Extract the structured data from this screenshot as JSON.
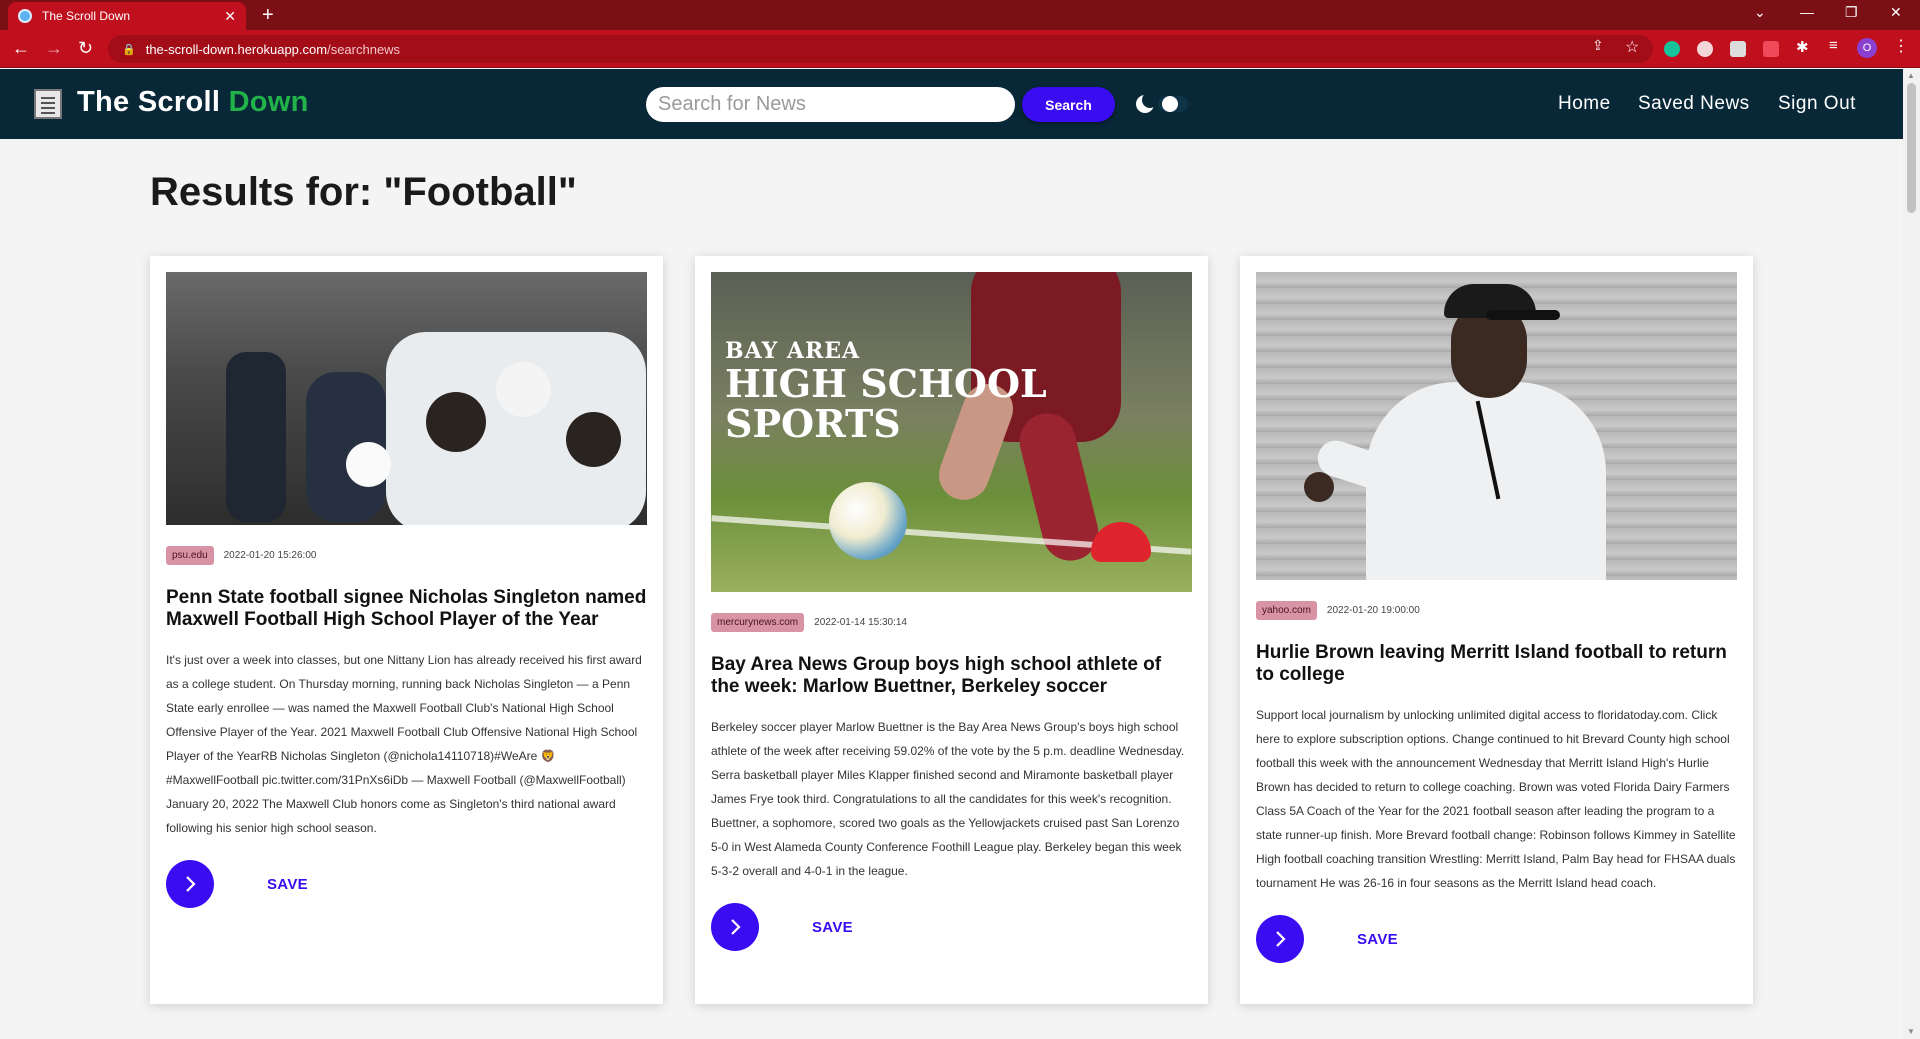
{
  "browser": {
    "tab_title": "The Scroll Down",
    "url_host": "the-scroll-down.herokuapp.com",
    "url_path": "/searchnews",
    "accent": "#c0101e"
  },
  "header": {
    "brand_main": "The Scroll ",
    "brand_accent": "Down",
    "search_placeholder": "Search for News",
    "search_button": "Search",
    "nav": [
      "Home",
      "Saved News",
      "Sign Out"
    ],
    "background": "#082838",
    "brand_accent_color": "#21b34a",
    "button_color": "#3a0cf2"
  },
  "results": {
    "title": "Results for: \"Football\""
  },
  "cards": [
    {
      "source": "psu.edu",
      "date": "2022-01-20 15:26:00",
      "title": "Penn State football signee Nicholas Singleton named Maxwell Football High School Player of the Year",
      "description": "It's just over a week into classes, but one Nittany Lion has already received his first award as a college student. On Thursday morning, running back Nicholas Singleton — a Penn State early enrollee — was named the Maxwell Football Club's National High School Offensive Player of the Year. 2021 Maxwell Football Club Offensive National High School Player of the YearRB Nicholas Singleton (@nichola14110718)#WeAre 🦁 #MaxwellFootball pic.twitter.com/31PnXs6iDb — Maxwell Football (@MaxwellFootball) January 20, 2022 The Maxwell Club honors come as Singleton's third national award following his senior high school season.",
      "save_label": "SAVE"
    },
    {
      "source": "mercurynews.com",
      "date": "2022-01-14 15:30:14",
      "title": "Bay Area News Group boys high school athlete of the week: Marlow Buettner, Berkeley soccer",
      "description": "Berkeley soccer player Marlow Buettner is the Bay Area News Group's boys high school athlete of the week after receiving 59.02% of the vote by the 5 p.m. deadline Wednesday. Serra basketball player Miles Klapper finished second and Miramonte basketball player James Frye took third. Congratulations to all the candidates for this week's recognition. Buettner, a sophomore, scored two goals as the Yellowjackets cruised past San Lorenzo 5-0 in West Alameda County Conference Foothill League play. Berkeley began this week 5-3-2 overall and 4-0-1 in the league.",
      "image_text_1": "BAY AREA",
      "image_text_2": "HIGH SCHOOL SPORTS",
      "save_label": "SAVE"
    },
    {
      "source": "yahoo.com",
      "date": "2022-01-20 19:00:00",
      "title": "Hurlie Brown leaving Merritt Island football to return to college",
      "description": "Support local journalism by unlocking unlimited digital access to floridatoday.com. Click here to explore subscription options. Change continued to hit Brevard County high school football this week with the announcement Wednesday that Merritt Island High's Hurlie Brown has decided to return to college coaching. Brown was voted Florida Dairy Farmers Class 5A Coach of the Year for the 2021 football season after leading the program to a state runner-up finish. More Brevard football change: Robinson follows Kimmey in Satellite High football coaching transition Wrestling: Merritt Island, Palm Bay head for FHSAA duals tournament He was 26-16 in four seasons as the Merritt Island head coach.",
      "save_label": "SAVE"
    }
  ]
}
